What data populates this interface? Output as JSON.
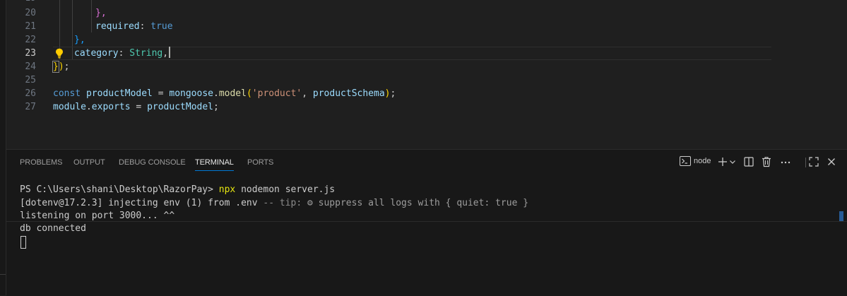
{
  "editor": {
    "top_partial_line_number": "19",
    "lines": [
      {
        "n": "20"
      },
      {
        "n": "21"
      },
      {
        "n": "22"
      },
      {
        "n": "23"
      },
      {
        "n": "24"
      },
      {
        "n": "25"
      },
      {
        "n": "26"
      },
      {
        "n": "27"
      }
    ],
    "code": {
      "l20_brace": "},",
      "l21_key": "required",
      "l21_colon": ": ",
      "l21_val": "true",
      "l22_brace": "},",
      "l23_key": "category",
      "l23_colon": ": ",
      "l23_type": "String",
      "l23_comma": ",",
      "l24_brace": "}",
      "l24_paren": ")",
      "l24_semi": ";",
      "l26_const": "const",
      "l26_name": "productModel",
      "l26_eq": " = ",
      "l26_obj": "mongoose",
      "l26_dot": ".",
      "l26_fn": "model",
      "l26_open": "(",
      "l26_str": "'product'",
      "l26_comma": ", ",
      "l26_arg": "productSchema",
      "l26_close": ")",
      "l26_semi": ";",
      "l27_obj": "module",
      "l27_dot": ".",
      "l27_prop": "exports",
      "l27_eq": " = ",
      "l27_val": "productModel",
      "l27_semi": ";"
    }
  },
  "panel": {
    "tabs": [
      "PROBLEMS",
      "OUTPUT",
      "DEBUG CONSOLE",
      "TERMINAL",
      "PORTS"
    ],
    "active_tab": "TERMINAL",
    "terminal_name": "node",
    "icons": [
      "terminal-icon",
      "plus-icon",
      "chevron-down-icon",
      "split-icon",
      "trash-icon",
      "more-icon",
      "maximize-icon",
      "close-icon"
    ]
  },
  "terminal": {
    "prompt": "PS C:\\Users\\shani\\Desktop\\RazorPay> ",
    "cmd_npx": "npx",
    "cmd_rest": " nodemon server.js",
    "dotenv_main": "[dotenv@17.2.3] injecting env (1) from .env ",
    "dotenv_tip": "-- tip: ",
    "dotenv_gear": "⚙",
    "dotenv_hint": " suppress all logs with { quiet: true }",
    "line3": "listening on port 3000... ^^",
    "line4": "db connected"
  },
  "colors": {
    "editor_bg": "#1f1f1f",
    "panel_bg": "#181818",
    "accent": "#0078d4",
    "keyword": "#569cd6",
    "string": "#ce9178",
    "function": "#dcdcaa",
    "type": "#4ec9b0"
  }
}
